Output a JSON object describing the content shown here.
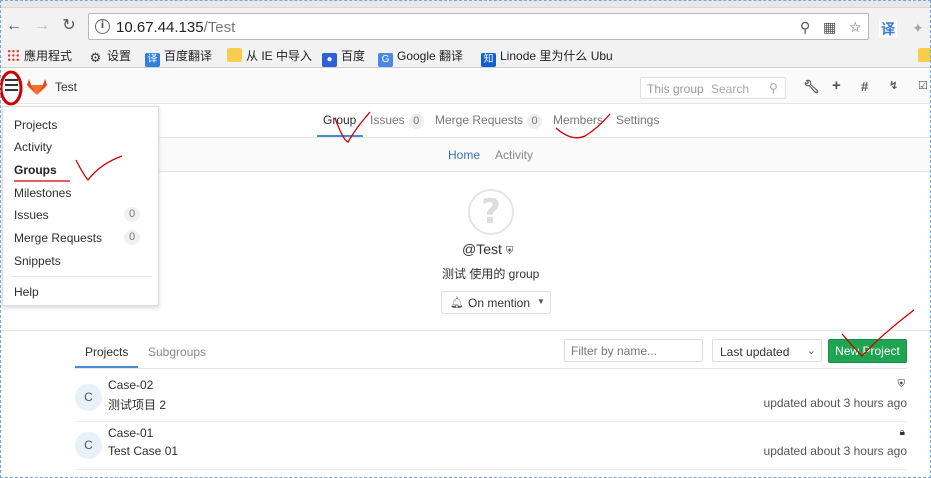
{
  "browser": {
    "url_host": "10.67.44.135",
    "url_path": "/Test",
    "bookmarks": [
      {
        "label": "應用程式",
        "icon": "apps-grid-icon"
      },
      {
        "label": "设置",
        "icon": "gear-icon"
      },
      {
        "label": "百度翻译",
        "icon": "translate-icon",
        "badge": "译"
      },
      {
        "label": "从 IE 中导入",
        "icon": "folder-icon"
      },
      {
        "label": "百度",
        "icon": "paw-icon"
      },
      {
        "label": "Google 翻译",
        "icon": "google-translate-icon"
      },
      {
        "label": "Linode 里为什么 Ubu",
        "icon": "zhihu-icon",
        "badge": "知"
      }
    ],
    "ext_badge": "译"
  },
  "header": {
    "title": "Test",
    "search_scope": "This group",
    "search_placeholder": "Search"
  },
  "dropdown": {
    "items": [
      {
        "label": "Projects"
      },
      {
        "label": "Activity"
      },
      {
        "label": "Groups",
        "active": true
      },
      {
        "label": "Milestones"
      },
      {
        "label": "Issues",
        "count": "0"
      },
      {
        "label": "Merge Requests",
        "count": "0"
      },
      {
        "label": "Snippets"
      },
      {
        "label": "Help"
      }
    ]
  },
  "group_nav": {
    "group": "Group",
    "issues": "Issues",
    "issues_count": "0",
    "merge_requests": "Merge Requests",
    "merge_requests_count": "0",
    "members": "Members",
    "settings": "Settings"
  },
  "sub_nav": {
    "home": "Home",
    "activity": "Activity"
  },
  "group_info": {
    "avatar_glyph": "?",
    "name": "@Test",
    "description": "测试 使用的 group",
    "notification": "On mention"
  },
  "projects_tabs": {
    "projects": "Projects",
    "subgroups": "Subgroups",
    "filter_placeholder": "Filter by name...",
    "sort": "Last updated",
    "new_project": "New Project"
  },
  "projects": [
    {
      "initial": "C",
      "name": "Case-02",
      "description": "测试项目 2",
      "visibility": "shield-icon",
      "updated": "updated about 3 hours ago"
    },
    {
      "initial": "C",
      "name": "Case-01",
      "description": "Test Case 01",
      "visibility": "lock-icon",
      "updated": "updated about 3 hours ago"
    }
  ],
  "colors": {
    "accent_blue": "#4a8bcd",
    "new_project_green": "#1fa451",
    "annotation_red": "#cc0000"
  }
}
